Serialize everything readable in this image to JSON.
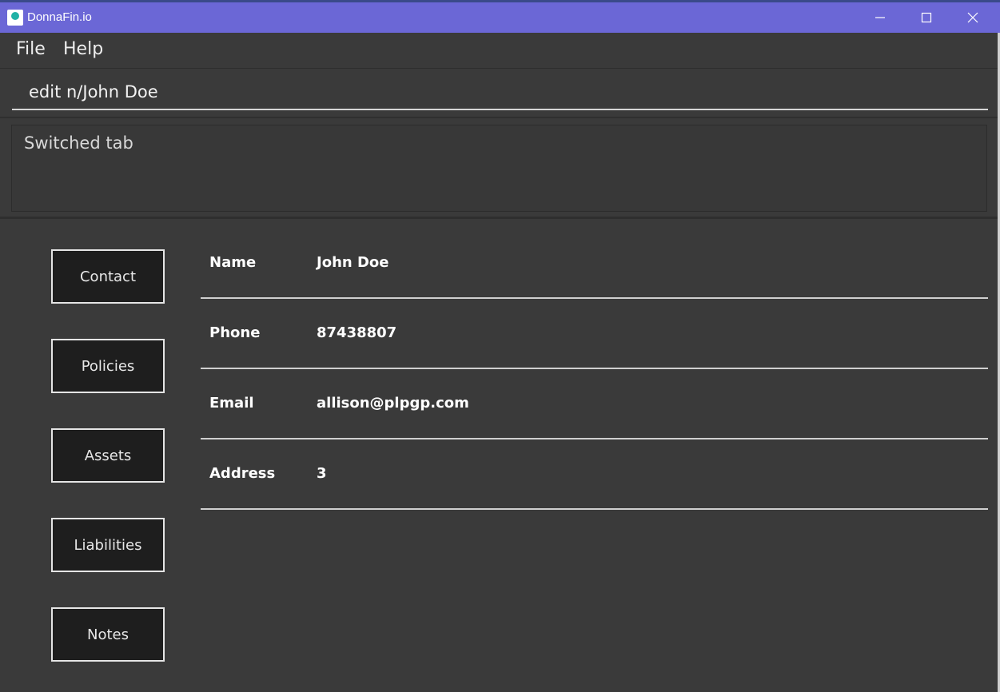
{
  "window": {
    "title": "DonnaFin.io",
    "accent_color": "#6b67d6"
  },
  "menu": {
    "file_label": "File",
    "help_label": "Help"
  },
  "command": {
    "value": "edit n/John Doe"
  },
  "result": {
    "message": "Switched tab"
  },
  "tabs": [
    {
      "label": "Contact"
    },
    {
      "label": "Policies"
    },
    {
      "label": "Assets"
    },
    {
      "label": "Liabilities"
    },
    {
      "label": "Notes"
    }
  ],
  "contact": {
    "rows": [
      {
        "label": "Name",
        "value": "John Doe"
      },
      {
        "label": "Phone",
        "value": "87438807"
      },
      {
        "label": "Email",
        "value": "allison@plpgp.com"
      },
      {
        "label": "Address",
        "value": "3"
      }
    ]
  },
  "icons": {
    "app": "app-logo-icon",
    "minimize": "minimize-icon",
    "maximize": "maximize-icon",
    "close": "close-icon"
  }
}
